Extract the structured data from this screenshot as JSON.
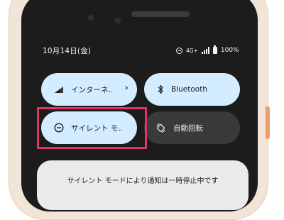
{
  "status_bar": {
    "date": "10月14日(金)",
    "network": "4G+",
    "battery": "100%",
    "icons": [
      "do-not-disturb-icon",
      "signal-icon",
      "battery-icon"
    ]
  },
  "quick_settings": {
    "tiles": [
      {
        "label": "インターネ..",
        "state": "on",
        "icon": "wifi-icon",
        "has_chevron": true
      },
      {
        "label": "Bluetooth",
        "state": "on",
        "icon": "bluetooth-icon"
      },
      {
        "label": "サイレント モ..",
        "state": "on",
        "icon": "do-not-disturb-icon",
        "highlighted": true
      },
      {
        "label": "自動回転",
        "state": "off",
        "icon": "auto-rotate-icon"
      }
    ],
    "chevron": "›"
  },
  "notice": {
    "text": "サイレント モードにより通知は一時停止中です"
  },
  "colors": {
    "tile_on": "#d3ecff",
    "tile_off": "#3a3a3a",
    "highlight": "#e2316b",
    "phone_body": "#f3e4d8"
  }
}
